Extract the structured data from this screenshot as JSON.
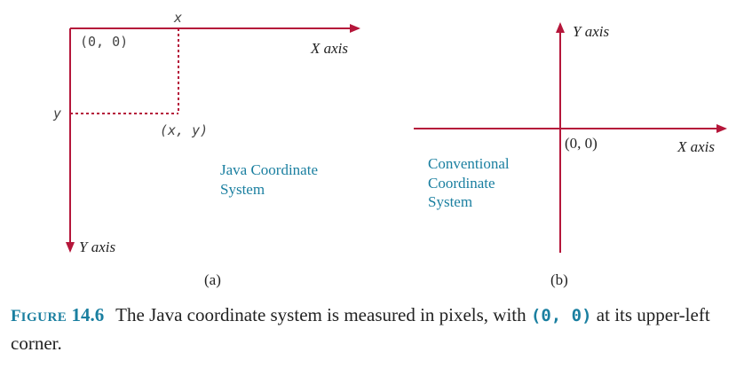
{
  "diagram_a": {
    "x_marker": "x",
    "origin": "(0, 0)",
    "x_axis": "X axis",
    "y_marker": "y",
    "point": "(x, y)",
    "title_line1": "Java Coordinate",
    "title_line2": "System",
    "y_axis": "Y axis",
    "sublabel": "(a)"
  },
  "diagram_b": {
    "y_axis": "Y axis",
    "origin": "(0, 0)",
    "x_axis": "X axis",
    "title_line1": "Conventional",
    "title_line2": "Coordinate",
    "title_line3": "System",
    "sublabel": "(b)"
  },
  "caption": {
    "label_first": "F",
    "label_rest": "IGURE",
    "number": "14.6",
    "text_before": "The Java coordinate system is measured in pixels, with ",
    "code": "(0, 0)",
    "text_after": " at its upper-left corner."
  },
  "colors": {
    "axis": "#b5163a",
    "accent": "#1a7fa0"
  }
}
